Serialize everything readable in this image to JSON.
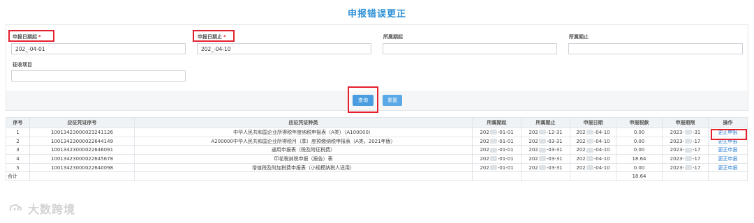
{
  "page_title": "申报错误更正",
  "form": {
    "start_label": "申报日期起",
    "start_value": "202_-04-01",
    "end_label": "申报日期止",
    "end_value": "202_-04-10",
    "period_start_label": "所属期起",
    "period_start_value": "",
    "period_end_label": "所属期止",
    "period_end_value": "",
    "item_label": "征收项目",
    "item_value": "",
    "required_mark": "*"
  },
  "buttons": {
    "query": "查询",
    "reset": "重置"
  },
  "table": {
    "headers": [
      "序号",
      "应征凭证序号",
      "应征凭证种类",
      "所属期起",
      "所属期止",
      "申报日期",
      "申报税款",
      "申报期限",
      "操作"
    ],
    "rows": [
      {
        "no": "1",
        "voucher": "10013423000023241126",
        "type": "中华人民共和国企业所得税年度纳税申报表（A类）（A100000）",
        "pstart": "-01-01",
        "pend": "-12-31",
        "date": "-04-10",
        "tax": "0.00",
        "deadline": "-31",
        "op": "更正申报"
      },
      {
        "no": "2",
        "voucher": "10013423000022644149",
        "type": "A200000中华人民共和国企业所得税月（季）度预缴纳税申报表（A类，2021年版）",
        "pstart": "-01-01",
        "pend": "-03-31",
        "date": "-04-10",
        "tax": "0.00",
        "deadline": "-17",
        "op": "更正申报"
      },
      {
        "no": "3",
        "voucher": "10013423000022646091",
        "type": "通用申报表（税及附征税费）",
        "pstart": "-01-01",
        "pend": "-03-31",
        "date": "-04-10",
        "tax": "0.00",
        "deadline": "-17",
        "op": "更正申报"
      },
      {
        "no": "4",
        "voucher": "10013423000022645678",
        "type": "印花税纳税申报（报告）表",
        "pstart": "-01-01",
        "pend": "-03-31",
        "date": "-04-10",
        "tax": "18.64",
        "deadline": "-17",
        "op": "更正申报"
      },
      {
        "no": "5",
        "voucher": "10013423000022640098",
        "type": "增值税及附加税费申报表（小规模纳税人适用）",
        "pstart": "-01-01",
        "pend": "-03-31",
        "date": "-04-10",
        "tax": "0.00",
        "deadline": "-17",
        "op": "更正申报"
      }
    ],
    "prefixes": {
      "pstart": "202",
      "pend": "202",
      "date": "202",
      "deadline": "2023-"
    },
    "total_label": "合计",
    "total_value": "18.64"
  },
  "watermark": "大数跨境"
}
